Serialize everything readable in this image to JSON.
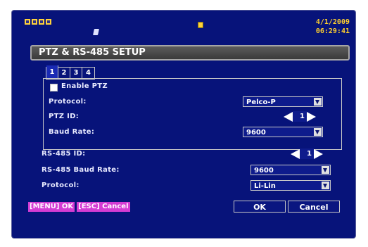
{
  "status": {
    "date": "4/1/2009",
    "time": "06:29:41",
    "channel_icons": [
      "channel-1-icon",
      "channel-2-icon",
      "channel-3-icon",
      "channel-4-icon"
    ]
  },
  "title": "PTZ & RS-485 SETUP",
  "tabs": [
    "1",
    "2",
    "3",
    "4"
  ],
  "ptz": {
    "enable_label": "Enable PTZ",
    "enable_checked": true,
    "protocol_label": "Protocol:",
    "protocol_value": "Pelco-P",
    "ptz_id_label": "PTZ ID:",
    "ptz_id_value": "1",
    "baud_label": "Baud Rate:",
    "baud_value": "9600"
  },
  "rs485": {
    "id_label": "RS-485 ID:",
    "id_value": "1",
    "baud_label": "RS-485 Baud Rate:",
    "baud_value": "9600",
    "protocol_label": "Protocol:",
    "protocol_value": "Li-Lin"
  },
  "footer": {
    "hint_menu": "[MENU] OK",
    "hint_esc": "[ESC] Cancel",
    "ok_label": "OK",
    "cancel_label": "Cancel"
  },
  "colors": {
    "background": "#07137a",
    "accent_yellow": "#ffcf2e",
    "hint_magenta": "#d43cd4"
  }
}
